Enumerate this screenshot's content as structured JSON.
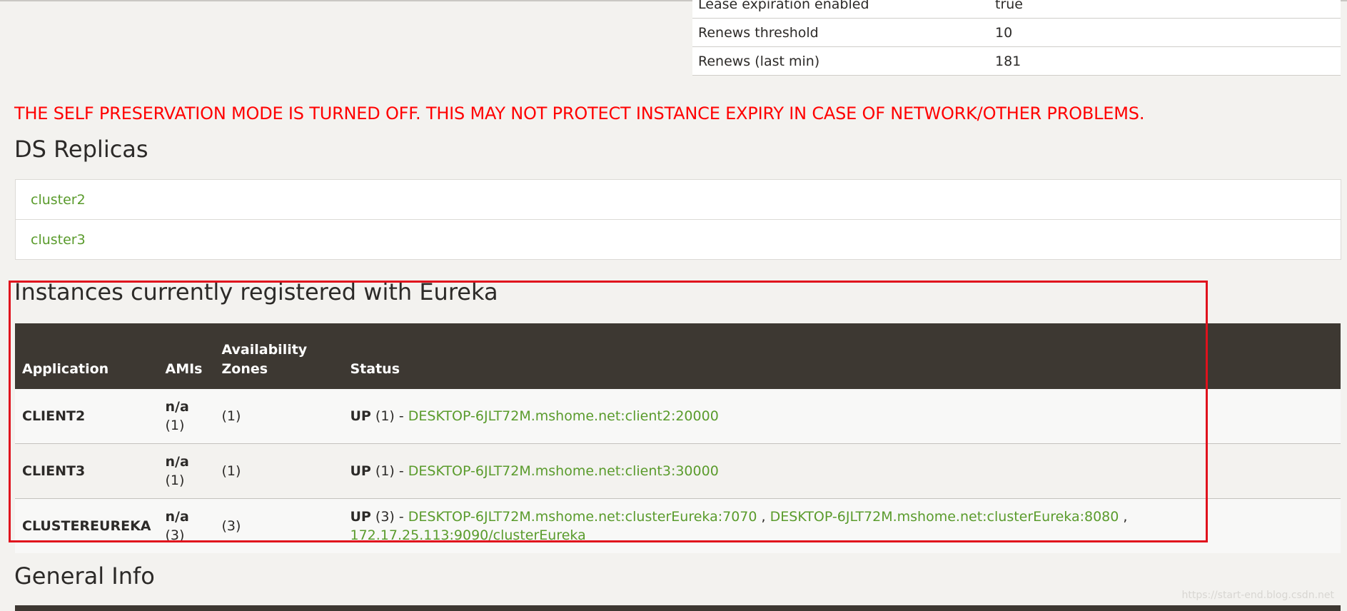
{
  "lease_table": {
    "rows": [
      {
        "key": "Lease expiration enabled",
        "value": "true"
      },
      {
        "key": "Renews threshold",
        "value": "10"
      },
      {
        "key": "Renews (last min)",
        "value": "181"
      }
    ]
  },
  "warning": "THE SELF PRESERVATION MODE IS TURNED OFF. THIS MAY NOT PROTECT INSTANCE EXPIRY IN CASE OF NETWORK/OTHER PROBLEMS.",
  "ds_replicas": {
    "title": "DS Replicas",
    "items": [
      "cluster2",
      "cluster3"
    ]
  },
  "instances": {
    "title": "Instances currently registered with Eureka",
    "headers": {
      "application": "Application",
      "amis": "AMIs",
      "zones_line1": "Availability",
      "zones_line2": "Zones",
      "status": "Status"
    },
    "rows": [
      {
        "application": "CLIENT2",
        "ami": "n/a",
        "ami_count": "(1)",
        "zones": "(1)",
        "status": "UP",
        "status_count": "(1) -",
        "links": [
          "DESKTOP-6JLT72M.mshome.net:client2:20000"
        ]
      },
      {
        "application": "CLIENT3",
        "ami": "n/a",
        "ami_count": "(1)",
        "zones": "(1)",
        "status": "UP",
        "status_count": "(1) -",
        "links": [
          "DESKTOP-6JLT72M.mshome.net:client3:30000"
        ]
      },
      {
        "application": "CLUSTEREUREKA",
        "ami": "n/a",
        "ami_count": "(3)",
        "zones": "(3)",
        "status": "UP",
        "status_count": "(3) -",
        "links": [
          "DESKTOP-6JLT72M.mshome.net:clusterEureka:7070",
          "DESKTOP-6JLT72M.mshome.net:clusterEureka:8080",
          "172.17.25.113:9090/clusterEureka"
        ],
        "separator": ","
      }
    ]
  },
  "general_info": {
    "title": "General Info"
  },
  "watermark": "https://start-end.blog.csdn.net",
  "colors": {
    "warning": "#ff0000",
    "link": "#5a9b2c",
    "table_header": "#3d3832",
    "highlight_box": "#e0121d"
  }
}
